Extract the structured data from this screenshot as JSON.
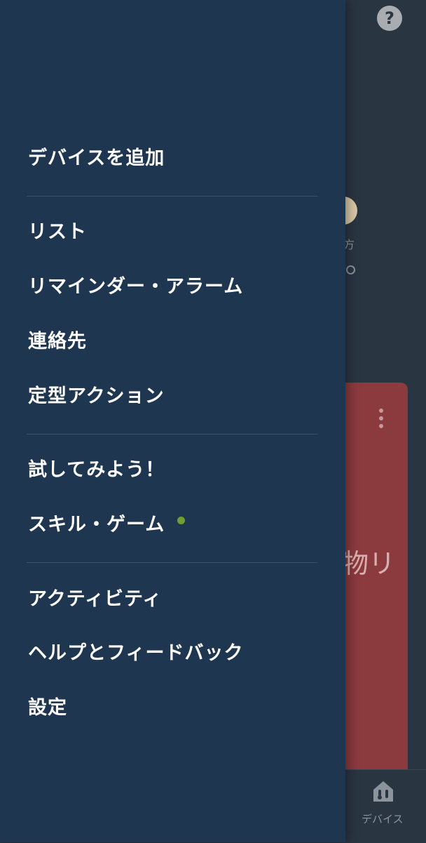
{
  "background": {
    "help_icon": "?",
    "peek_text": "方",
    "card_text": "物リ",
    "bottom_nav_label": "デバイス",
    "card_color": "#8b3a3e"
  },
  "drawer": {
    "items": [
      {
        "label": "デバイスを追加"
      },
      {
        "label": "リスト"
      },
      {
        "label": "リマインダー・アラーム"
      },
      {
        "label": "連絡先"
      },
      {
        "label": "定型アクション"
      },
      {
        "label": "試してみよう！"
      },
      {
        "label": "スキル・ゲーム"
      },
      {
        "label": "アクティビティ"
      },
      {
        "label": "ヘルプとフィードバック"
      },
      {
        "label": "設定"
      }
    ],
    "badge_color": "#6fa132",
    "background_color": "#1f3651"
  }
}
